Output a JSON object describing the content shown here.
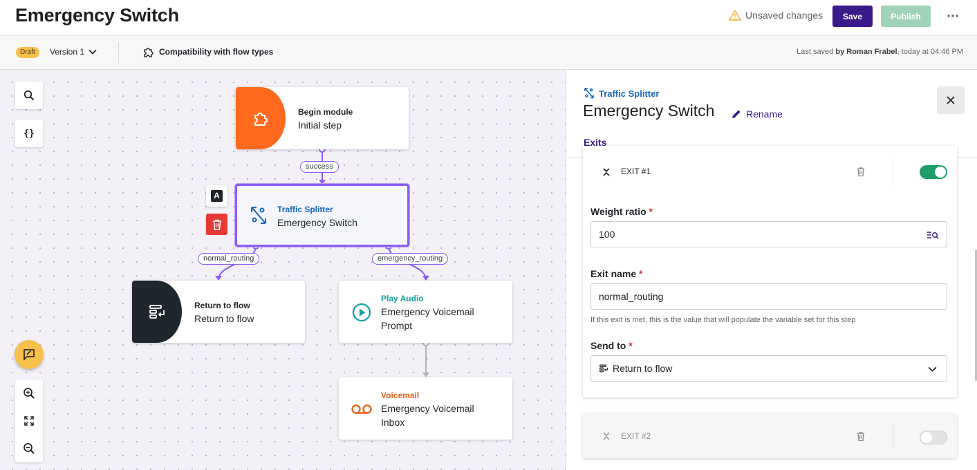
{
  "header": {
    "title": "Emergency Switch",
    "unsaved_text": "Unsaved changes",
    "save_label": "Save",
    "publish_label": "Publish"
  },
  "subbar": {
    "status_badge": "Draft",
    "version_label": "Version 1",
    "compatibility_label": "Compatibility with flow types",
    "last_saved_prefix": "Last saved ",
    "last_saved_by_text": "by Roman Frabel",
    "last_saved_suffix": ", today at 04:46 PM"
  },
  "canvas": {
    "nodes": {
      "begin": {
        "type": "Begin module",
        "name": "Initial step"
      },
      "splitter": {
        "type": "Traffic Splitter",
        "name": "Emergency Switch"
      },
      "return_flow": {
        "type": "Return to flow",
        "name": "Return to flow"
      },
      "play_audio": {
        "type": "Play Audio",
        "name_line1": "Emergency Voicemail",
        "name_line2": "Prompt"
      },
      "voicemail": {
        "type": "Voicemail",
        "name_line1": "Emergency Voicemail",
        "name_line2": "Inbox"
      }
    },
    "edges": {
      "success": "success",
      "normal_routing": "normal_routing",
      "emergency_routing": "emergency_routing"
    },
    "rename_glyph": "A"
  },
  "panel": {
    "type_label": "Traffic Splitter",
    "title": "Emergency Switch",
    "rename_label": "Rename",
    "tab_exits": "Exits",
    "exit1": {
      "label": "EXIT #1",
      "enabled": true,
      "weight_label": "Weight ratio",
      "weight_value": "100",
      "exit_name_label": "Exit name",
      "exit_name_value": "normal_routing",
      "exit_name_help": "If this exit is met, this is the value that will populate the variable set for this step",
      "send_to_label": "Send to",
      "send_to_value": "Return to flow"
    },
    "exit2": {
      "label": "EXIT #2",
      "enabled": false
    },
    "required_mark": "*"
  },
  "colors": {
    "primary": "#3b1a8c",
    "publish_disabled": "#9fd3b9",
    "selection": "#8b5cf6",
    "begin_orange": "#ff6a1f",
    "return_dark": "#1f262e",
    "play_audio_teal": "#0f9e9e",
    "voicemail_orange": "#e8641b",
    "splitter_blue": "#1565c0",
    "toggle_on": "#1f9d6b",
    "draft_badge": "#f6c04a",
    "delete_red": "#e53935"
  }
}
